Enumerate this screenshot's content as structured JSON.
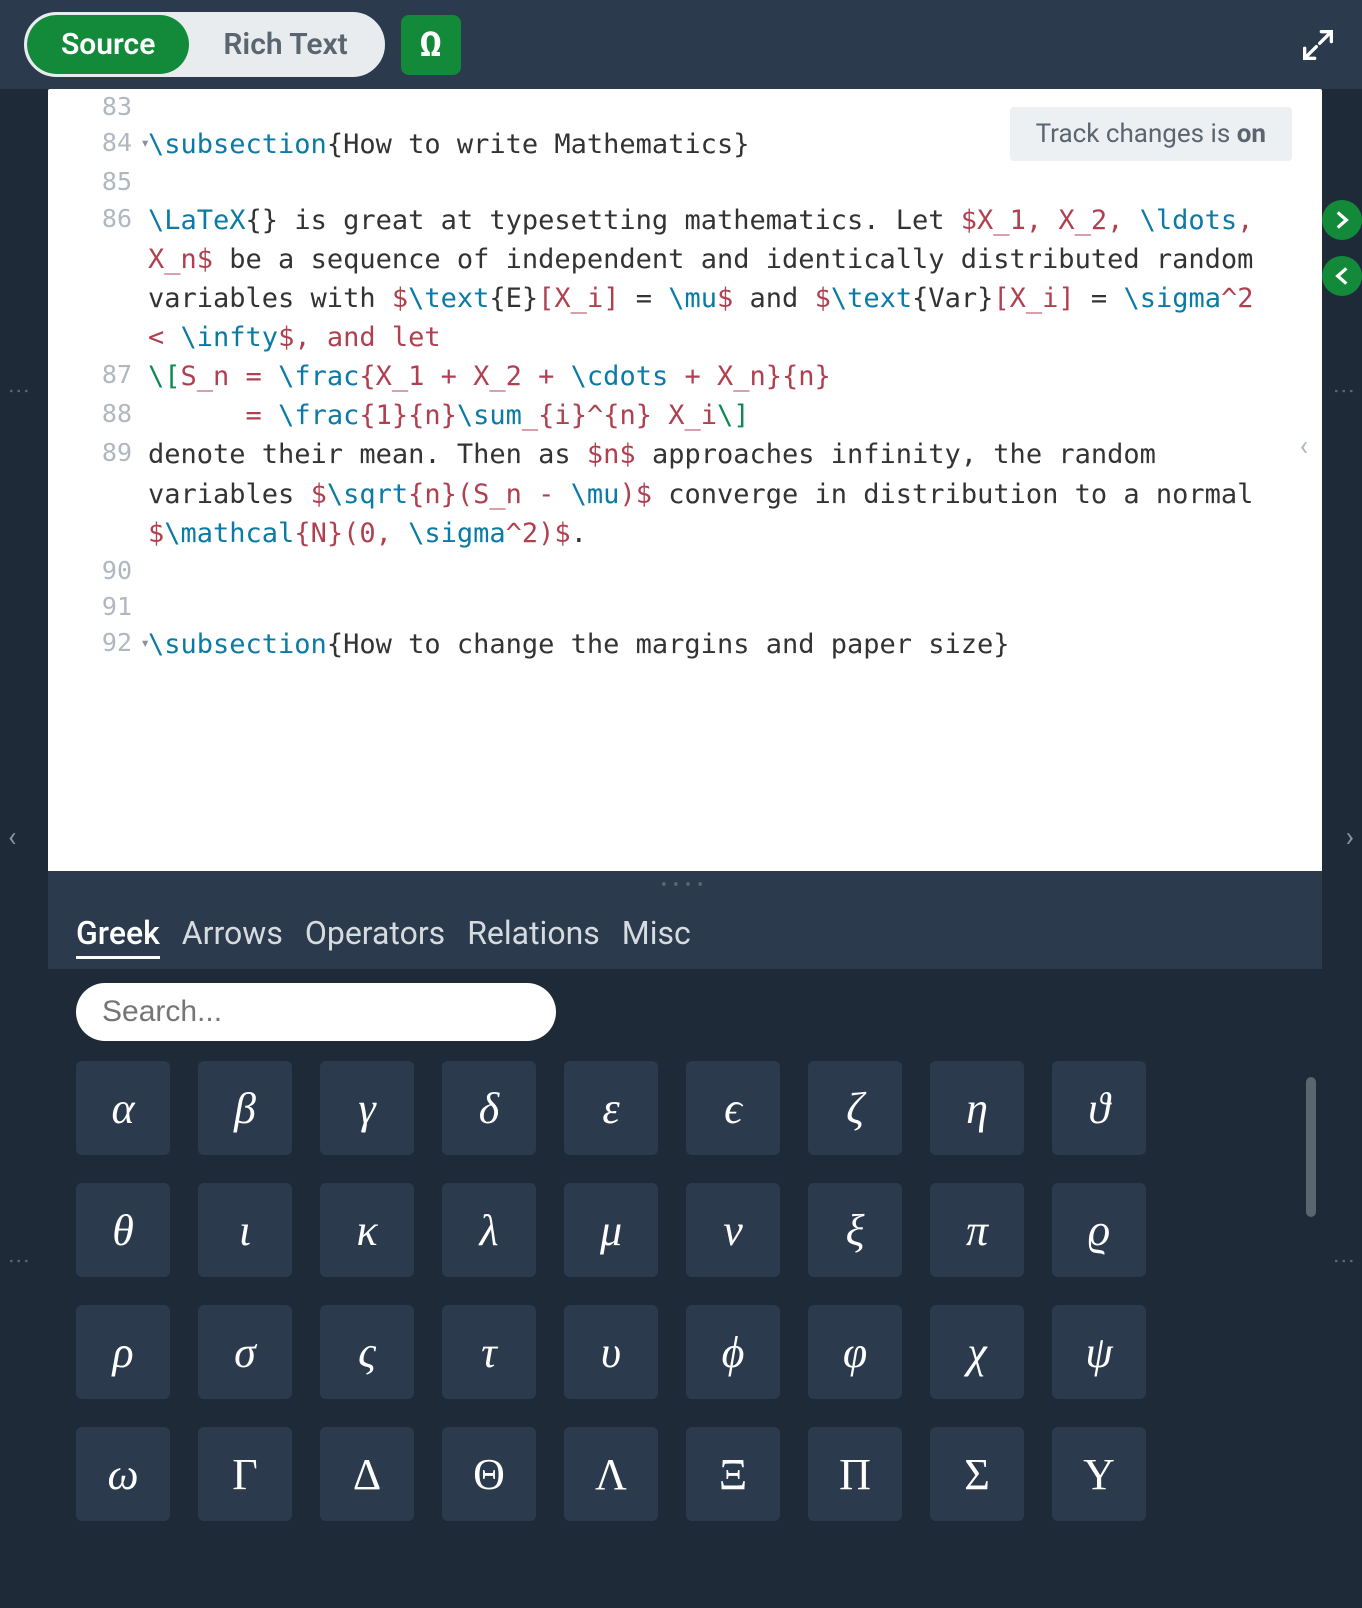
{
  "toolbar": {
    "tab_source": "Source",
    "tab_rich": "Rich Text",
    "omega": "Ω"
  },
  "track_changes": {
    "prefix": "Track changes is ",
    "state": "on"
  },
  "lines": {
    "l83": "83",
    "l84": "84",
    "l85": "85",
    "l86": "86",
    "l87": "87",
    "l88": "88",
    "l89": "89",
    "l90": "90",
    "l91": "91",
    "l92": "92"
  },
  "code": {
    "c84_cmd": "\\subsection",
    "c84_arg": "{How to write Mathematics}",
    "c86a_cmd": "\\LaTeX",
    "c86a_br": "{}",
    "c86a_txt": " is great at typesetting mathematics. Let ",
    "c86a_m1": "$X_1, X_2, ",
    "c86a_ld": "\\ldots",
    "c86a_m2": ", X_n$",
    "c86a_txt2": " be a sequence of independent and identically distributed random variables with ",
    "c86b_m1": "$",
    "c86b_tx": "\\text",
    "c86b_e": "{E}",
    "c86b_xi": "[X_i]",
    "c86b_eq": " = ",
    "c86b_mu": "\\mu",
    "c86b_d": "$",
    "c86b_and": " and ",
    "c86b_var": "{Var}",
    "c86b_sig": "\\sigma",
    "c86b_pw": "^2 < ",
    "c86b_inf": "\\infty",
    "c86b_end": "$, and let",
    "c87_open": "\\[",
    "c87_sn": "S_n = ",
    "c87_frac": "\\frac",
    "c87_num": "{X_1 + X_2 + ",
    "c87_cd": "\\cdots",
    "c87_num2": " + X_n}{n}",
    "c88_pad": "      = ",
    "c88_frac": "\\frac",
    "c88_a": "{1}{n}",
    "c88_sum": "\\sum",
    "c88_b": "_{i}^{n} X_i",
    "c88_close": "\\]",
    "c89a": "denote their mean. Then as ",
    "c89_n": "$n$",
    "c89b": " approaches infinity, the random variables ",
    "c89_m1": "$",
    "c89_sqrt": "\\sqrt",
    "c89_m2": "{n}(S_n - ",
    "c89_mu": "\\mu",
    "c89_m3": ")$",
    "c89c": " converge in distribution to a normal ",
    "c89_m4": "$",
    "c89_mc": "\\mathcal",
    "c89_m5": "{N}(0, ",
    "c89_sig": "\\sigma",
    "c89_m6": "^2)$",
    "c89d": ".",
    "c92_cmd": "\\subsection",
    "c92_arg": "{How to change the margins and paper size}"
  },
  "sym_tabs": [
    "Greek",
    "Arrows",
    "Operators",
    "Relations",
    "Misc"
  ],
  "search_placeholder": "Search...",
  "symbols": [
    "α",
    "β",
    "γ",
    "δ",
    "ε",
    "ϵ",
    "ζ",
    "η",
    "ϑ",
    "θ",
    "ι",
    "κ",
    "λ",
    "μ",
    "ν",
    "ξ",
    "π",
    "ϱ",
    "ρ",
    "σ",
    "ς",
    "τ",
    "υ",
    "ϕ",
    "φ",
    "χ",
    "ψ",
    "ω",
    "Γ",
    "Δ",
    "Θ",
    "Λ",
    "Ξ",
    "Π",
    "Σ",
    "Υ"
  ],
  "symbols_upright_from": 28
}
